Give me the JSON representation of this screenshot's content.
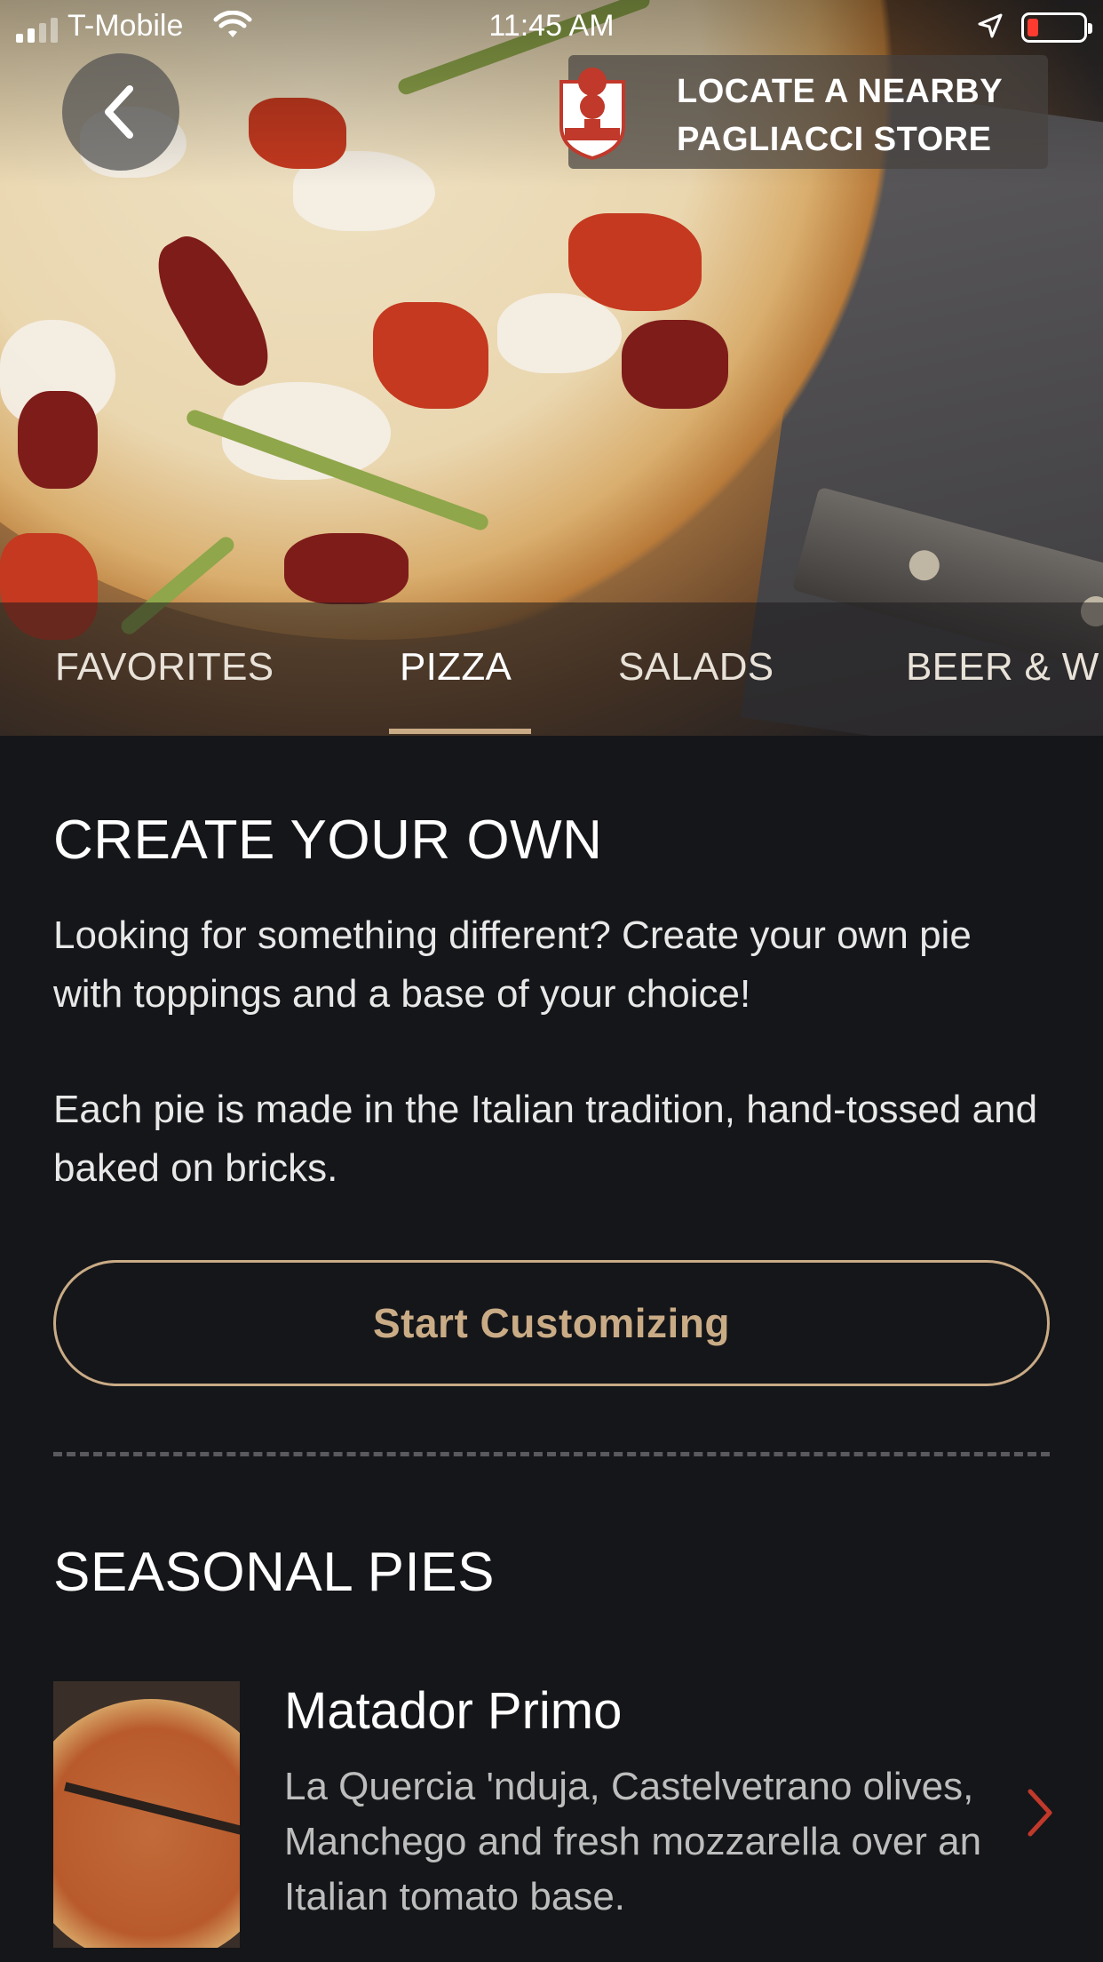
{
  "status_bar": {
    "carrier": "T-Mobile",
    "time": "11:45 AM",
    "battery_color": "#ff3b30"
  },
  "header": {
    "back_icon": "chevron-left-icon",
    "store_locator_label": "LOCATE A NEARBY PAGLIACCI STORE",
    "logo_text": "PAGLIACCI"
  },
  "tabs": [
    {
      "label": "FAVORITES",
      "active": false
    },
    {
      "label": "PIZZA",
      "active": true
    },
    {
      "label": "SALADS",
      "active": false
    },
    {
      "label": "BEER & W",
      "active": false
    }
  ],
  "create_your_own": {
    "title": "CREATE YOUR OWN",
    "description_1": "Looking for something different? Create your own pie with toppings and a base of your choice!",
    "description_2": "Each pie is made in the Italian tradition, hand-tossed and baked on bricks.",
    "button_label": "Start Customizing"
  },
  "seasonal_pies": {
    "title": "SEASONAL PIES",
    "items": [
      {
        "name": "Matador Primo",
        "description": "La Quercia 'nduja, Castelvetrano olives, Manchego and fresh mozzarella over an Italian tomato base."
      }
    ]
  },
  "colors": {
    "background": "#151619",
    "accent": "#c9ab86",
    "chevron": "#c0392b"
  }
}
